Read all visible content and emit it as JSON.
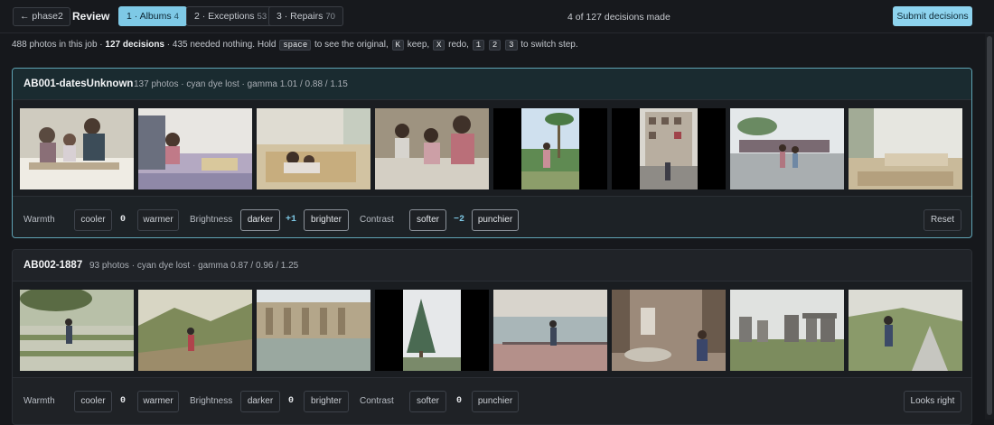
{
  "topbar": {
    "back_label": "← phase2",
    "title": "Review",
    "tabs": [
      {
        "label": "1 · Albums",
        "count": "4"
      },
      {
        "label": "2 · Exceptions",
        "count": "53"
      },
      {
        "label": "3 · Repairs",
        "count": "70"
      }
    ],
    "progress": "4 of 127 decisions made",
    "submit_label": "Submit decisions"
  },
  "help": {
    "t1": "488 photos in this job · ",
    "t2": "127 decisions",
    "t3": " · 435 needed nothing. Hold ",
    "k_space": "space",
    "t4": " to see the original, ",
    "k_keep": "K",
    "t5": " keep, ",
    "k_redo": "X",
    "t6": " redo, ",
    "k1": "1",
    "k2": "2",
    "k3": "3",
    "t7": " to switch step."
  },
  "albums": [
    {
      "name": "AB001-datesUnknown",
      "meta": "137 photos · cyan dye lost · gamma 1.01 / 0.88 / 1.15",
      "photos": [
        "family-meal-photo-icon",
        "girl-on-bed-photo-icon",
        "kids-on-bed-photo-icon",
        "family-group-photo-icon",
        "girl-by-palm-photo-icon",
        "building-construction-photo-icon",
        "people-by-boat-photo-icon",
        "room-interior-photo-icon"
      ],
      "controls": {
        "warmth_label": "Warmth",
        "cooler": "cooler",
        "warmth_val": "0",
        "warmer": "warmer",
        "brightness_label": "Brightness",
        "darker": "darker",
        "brightness_val": "+1",
        "brighter": "brighter",
        "contrast_label": "Contrast",
        "softer": "softer",
        "contrast_val": "−2",
        "punchier": "punchier",
        "action": "Reset"
      }
    },
    {
      "name": "AB002-1887",
      "meta": "93 photos · cyan dye lost · gamma 0.87 / 0.96 / 1.25",
      "photos": [
        "garden-walk-photo-icon",
        "valley-hiker-photo-icon",
        "roman-bath-photo-icon",
        "pine-tree-photo-icon",
        "pier-sea-photo-icon",
        "fountain-statue-photo-icon",
        "stonehenge-photo-icon",
        "moor-hiker-photo-icon"
      ],
      "controls": {
        "warmth_label": "Warmth",
        "cooler": "cooler",
        "warmth_val": "0",
        "warmer": "warmer",
        "brightness_label": "Brightness",
        "darker": "darker",
        "brightness_val": "0",
        "brighter": "brighter",
        "contrast_label": "Contrast",
        "softer": "softer",
        "contrast_val": "0",
        "punchier": "punchier",
        "action": "Looks right"
      }
    }
  ],
  "colors": {
    "accent": "#7ec9e6",
    "submit": "#8dd3ee",
    "selected_border": "#5fa3b4",
    "background": "#16181c"
  }
}
